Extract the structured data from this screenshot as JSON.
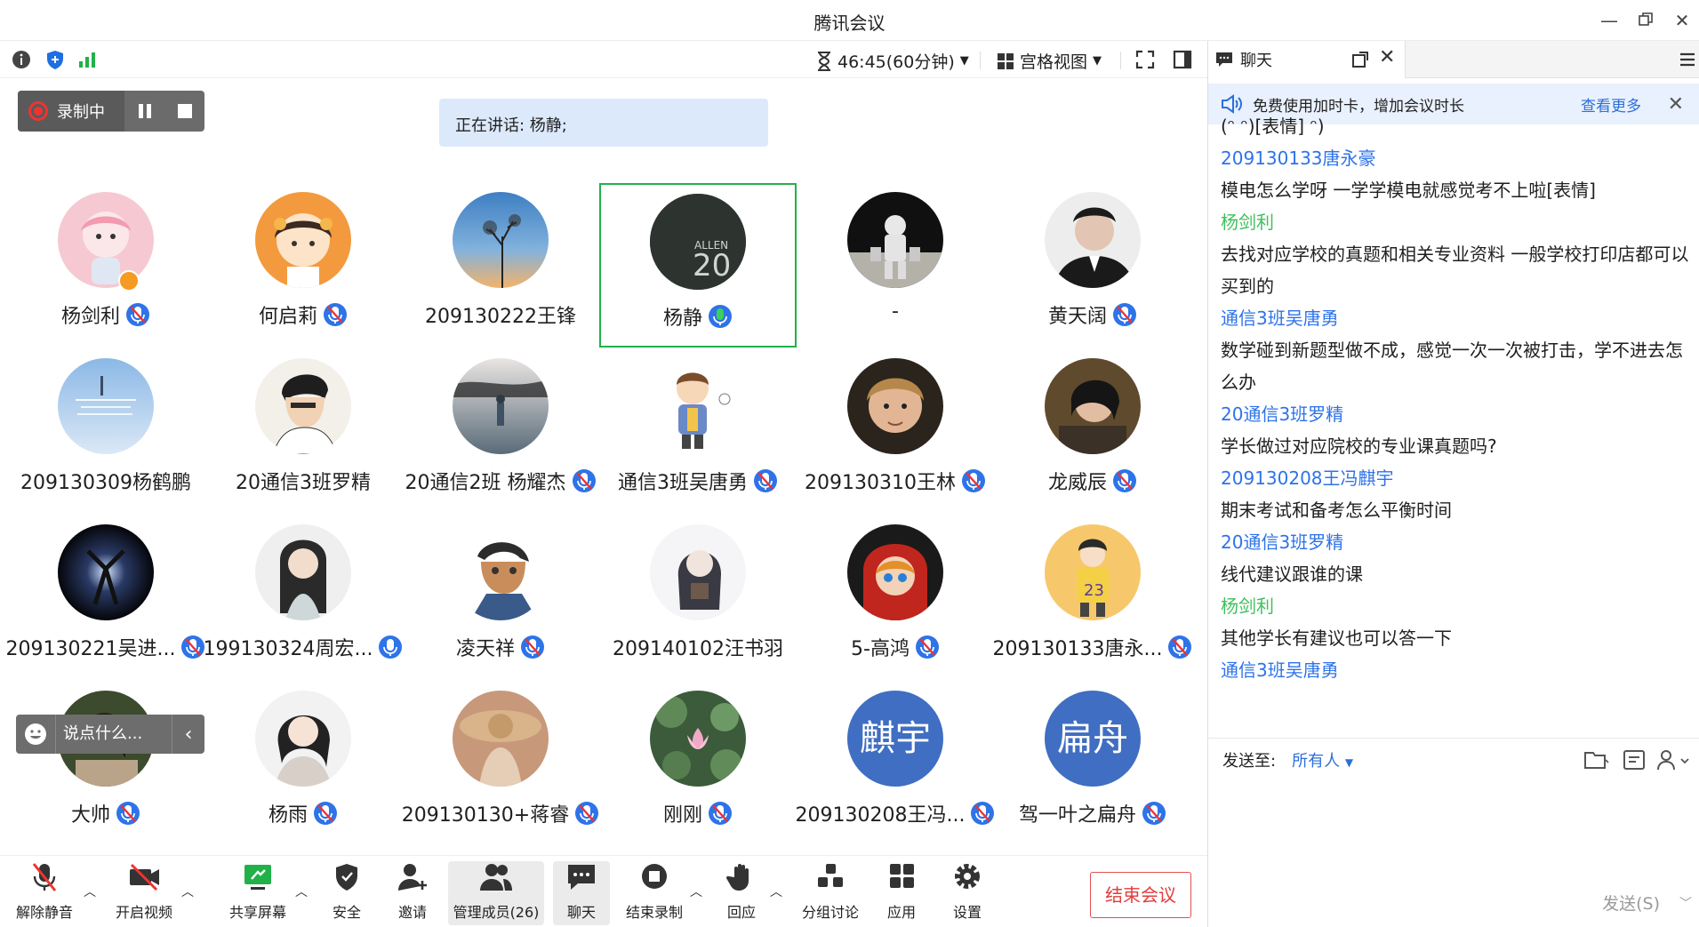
{
  "window": {
    "title": "腾讯会议"
  },
  "topbar": {
    "timer": "46:45(60分钟)",
    "view": "宫格视图"
  },
  "recording": {
    "label": "录制中"
  },
  "speaking": "正在讲话: 杨静;",
  "participants": [
    {
      "name": "杨剑利",
      "mic": "off",
      "host": true,
      "avatar": "anime-pink"
    },
    {
      "name": "何启莉",
      "mic": "off",
      "avatar": "anime-girl-orange"
    },
    {
      "name": "209130222王锋",
      "mic": "none",
      "avatar": "sunset-tree"
    },
    {
      "name": "杨静",
      "mic": "speaking",
      "active": true,
      "avatar": "jersey"
    },
    {
      "name": "-",
      "mic": "none",
      "avatar": "astronaut"
    },
    {
      "name": "黄天阔",
      "mic": "off",
      "avatar": "man-suit"
    },
    {
      "name": "209130309杨鹤鹏",
      "mic": "none",
      "avatar": "blue-sky"
    },
    {
      "name": "20通信3班罗精",
      "mic": "none",
      "avatar": "anime-man"
    },
    {
      "name": "20通信2班 杨耀杰",
      "mic": "off",
      "avatar": "lake"
    },
    {
      "name": "通信3班吴唐勇",
      "mic": "off",
      "avatar": "cartoon-boy"
    },
    {
      "name": "209130310王林",
      "mic": "off",
      "avatar": "actor"
    },
    {
      "name": "龙威辰",
      "mic": "off",
      "avatar": "woman-film"
    },
    {
      "name": "209130221吴进...",
      "mic": "off",
      "avatar": "dark-light"
    },
    {
      "name": "199130324周宏...",
      "mic": "on",
      "avatar": "ancient-lady"
    },
    {
      "name": "凌天祥",
      "mic": "off",
      "avatar": "detective"
    },
    {
      "name": "209140102汪书羽",
      "mic": "none",
      "avatar": "girl-sketch"
    },
    {
      "name": "5-高鸿",
      "mic": "off",
      "avatar": "red-hood"
    },
    {
      "name": "209130133唐永...",
      "mic": "off",
      "avatar": "girl-23"
    },
    {
      "name": "大帅",
      "mic": "off",
      "avatar": "woman-portrait"
    },
    {
      "name": "杨雨",
      "mic": "off",
      "avatar": "girl-scarf"
    },
    {
      "name": "209130130+蒋睿",
      "mic": "off",
      "avatar": "straw-hat"
    },
    {
      "name": "刚刚",
      "mic": "off",
      "avatar": "lotus"
    },
    {
      "name": "209130208王冯...",
      "mic": "off",
      "avatar_text": "麒宇"
    },
    {
      "name": "驾一叶之扁舟",
      "mic": "off",
      "avatar_text": "扁舟"
    }
  ],
  "float_chat": {
    "placeholder": "说点什么..."
  },
  "toolbar": {
    "unmute": "解除静音",
    "video": "开启视频",
    "share": "共享屏幕",
    "security": "安全",
    "invite": "邀请",
    "members": "管理成员(26)",
    "chat": "聊天",
    "stop_record": "结束录制",
    "react": "回应",
    "breakout": "分组讨论",
    "apps": "应用",
    "settings": "设置",
    "end": "结束会议"
  },
  "chat": {
    "tab": "聊天",
    "banner": "免费使用加时卡，增加会议时长",
    "banner_more": "查看更多",
    "messages": [
      {
        "kind": "text",
        "text": "(ᵔ ᵔ)[表情] ᵔ)"
      },
      {
        "kind": "sender",
        "color": "blue",
        "text": "209130133唐永豪"
      },
      {
        "kind": "text",
        "text": "模电怎么学呀 一学学模电就感觉考不上啦[表情]"
      },
      {
        "kind": "sender",
        "color": "green",
        "text": "杨剑利"
      },
      {
        "kind": "text2",
        "text": "去找对应学校的真题和相关专业资料 一般学校打印店都可以买到的"
      },
      {
        "kind": "sender",
        "color": "blue",
        "text": "通信3班吴唐勇"
      },
      {
        "kind": "text2",
        "text": "数学碰到新题型做不成，感觉一次一次被打击，学不进去怎么办"
      },
      {
        "kind": "sender",
        "color": "blue",
        "text": "20通信3班罗精"
      },
      {
        "kind": "text",
        "text": "学长做过对应院校的专业课真题吗?"
      },
      {
        "kind": "sender",
        "color": "blue",
        "text": "209130208王冯麒宇"
      },
      {
        "kind": "text",
        "text": "期末考试和备考怎么平衡时间"
      },
      {
        "kind": "sender",
        "color": "blue",
        "text": "20通信3班罗精"
      },
      {
        "kind": "text",
        "text": "线代建议跟谁的课"
      },
      {
        "kind": "sender",
        "color": "green",
        "text": "杨剑利"
      },
      {
        "kind": "text",
        "text": "其他学长有建议也可以答一下"
      },
      {
        "kind": "sender",
        "color": "blue",
        "text": "通信3班吴唐勇"
      }
    ],
    "send_to_label": "发送至:",
    "send_to_value": "所有人",
    "send_button": "发送(S)"
  }
}
